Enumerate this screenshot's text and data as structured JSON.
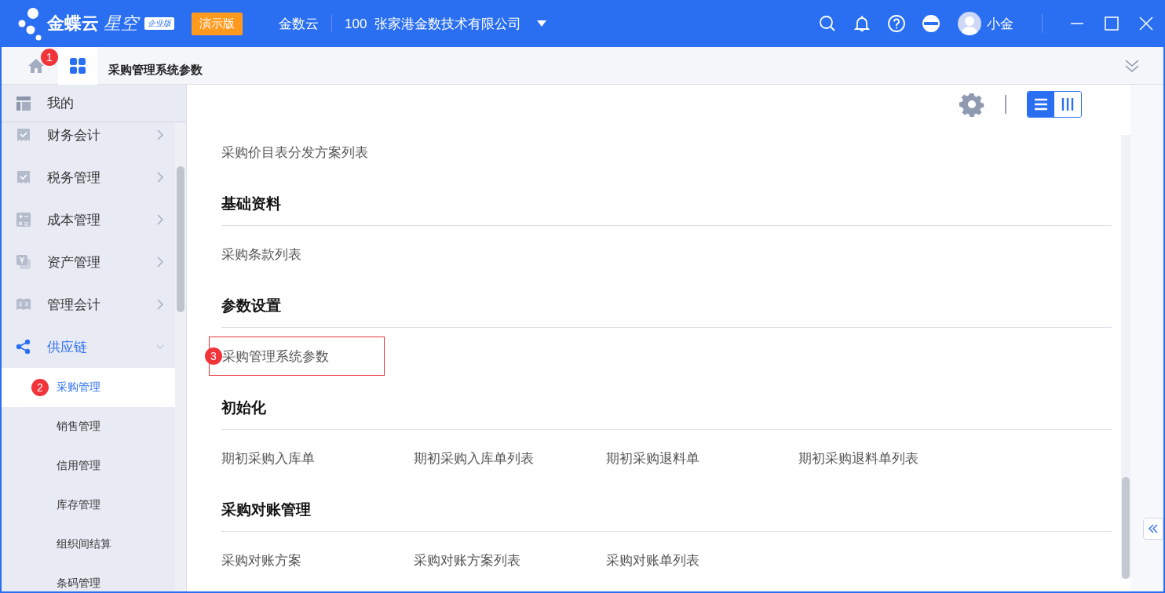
{
  "header": {
    "logo_text": "金蝶云",
    "logo_product": "星空",
    "edition_badge": "企业版",
    "demo_badge": "演示版",
    "data_center": "金数云",
    "company": "100  张家港金数技术有限公司",
    "user": "小金"
  },
  "tabs": [
    {
      "kind": "home",
      "selected": false
    },
    {
      "kind": "apps",
      "selected": true,
      "marker": "1"
    },
    {
      "kind": "page",
      "label": "采购管理系统参数",
      "selected": false
    }
  ],
  "sidebar": {
    "pinned": {
      "label": "我的"
    },
    "items": [
      {
        "label": "财务会计",
        "expanded": false
      },
      {
        "label": "税务管理",
        "expanded": false
      },
      {
        "label": "成本管理",
        "expanded": false
      },
      {
        "label": "资产管理",
        "expanded": false
      },
      {
        "label": "管理会计",
        "expanded": false
      },
      {
        "label": "供应链",
        "expanded": true,
        "children": [
          {
            "label": "采购管理",
            "selected": true,
            "marker": "2"
          },
          {
            "label": "销售管理",
            "selected": false
          },
          {
            "label": "信用管理",
            "selected": false
          },
          {
            "label": "库存管理",
            "selected": false
          },
          {
            "label": "组织间结算",
            "selected": false
          },
          {
            "label": "条码管理",
            "selected": false
          }
        ]
      }
    ]
  },
  "view_toggle": [
    {
      "kind": "list",
      "selected": true
    },
    {
      "kind": "columns",
      "selected": false
    }
  ],
  "sections": [
    {
      "links": [
        {
          "label": "采购价目表分发方案列表",
          "highlighted": false
        }
      ]
    },
    {
      "title": "基础资料",
      "links": [
        {
          "label": "采购条款列表",
          "highlighted": false
        }
      ]
    },
    {
      "title": "参数设置",
      "links": [
        {
          "label": "采购管理系统参数",
          "highlighted": true,
          "marker": "3"
        }
      ]
    },
    {
      "title": "初始化",
      "links": [
        {
          "label": "期初采购入库单",
          "highlighted": false
        },
        {
          "label": "期初采购入库单列表",
          "highlighted": false
        },
        {
          "label": "期初采购退料单",
          "highlighted": false
        },
        {
          "label": "期初采购退料单列表",
          "highlighted": false
        }
      ]
    },
    {
      "title": "采购对账管理",
      "links": [
        {
          "label": "采购对账方案",
          "highlighted": false
        },
        {
          "label": "采购对账方案列表",
          "highlighted": false
        },
        {
          "label": "采购对账单列表",
          "highlighted": false
        }
      ]
    }
  ]
}
